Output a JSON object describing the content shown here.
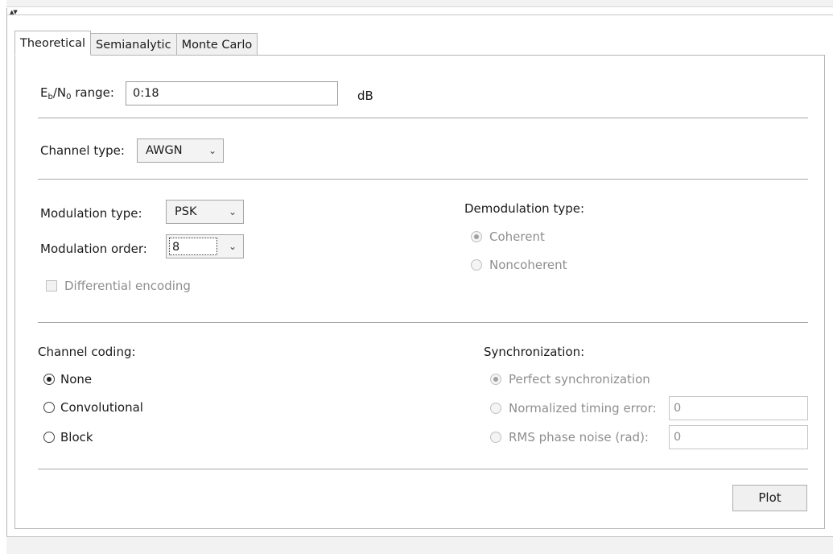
{
  "tabs": [
    {
      "label": "Theoretical",
      "active": true
    },
    {
      "label": "Semianalytic",
      "active": false
    },
    {
      "label": "Monte Carlo",
      "active": false
    }
  ],
  "ebno": {
    "label_main_1": "E",
    "label_sub_1": "b",
    "label_main_2": "/N",
    "label_sub_2": "0",
    "label_main_3": " range:",
    "value": "0:18",
    "unit": "dB"
  },
  "channel": {
    "label": "Channel type:",
    "value": "AWGN"
  },
  "modulation": {
    "type_label": "Modulation type:",
    "type_value": "PSK",
    "order_label": "Modulation order:",
    "order_value": "8",
    "diff_encoding_label": "Differential encoding",
    "diff_encoding_checked": false
  },
  "demodulation": {
    "label": "Demodulation type:",
    "options": [
      "Coherent",
      "Noncoherent"
    ],
    "selected": "Coherent"
  },
  "coding": {
    "label": "Channel coding:",
    "options": [
      "None",
      "Convolutional",
      "Block"
    ],
    "selected": "None"
  },
  "sync": {
    "label": "Synchronization:",
    "perfect_label": "Perfect synchronization",
    "timing_label": "Normalized timing error:",
    "timing_value": "0",
    "phase_label": "RMS phase noise (rad):",
    "phase_value": "0",
    "selected": "Perfect synchronization"
  },
  "plot_button": "Plot",
  "icons": {
    "collapse": "collapse-arrows-icon",
    "chevron": "chevron-down-icon"
  }
}
